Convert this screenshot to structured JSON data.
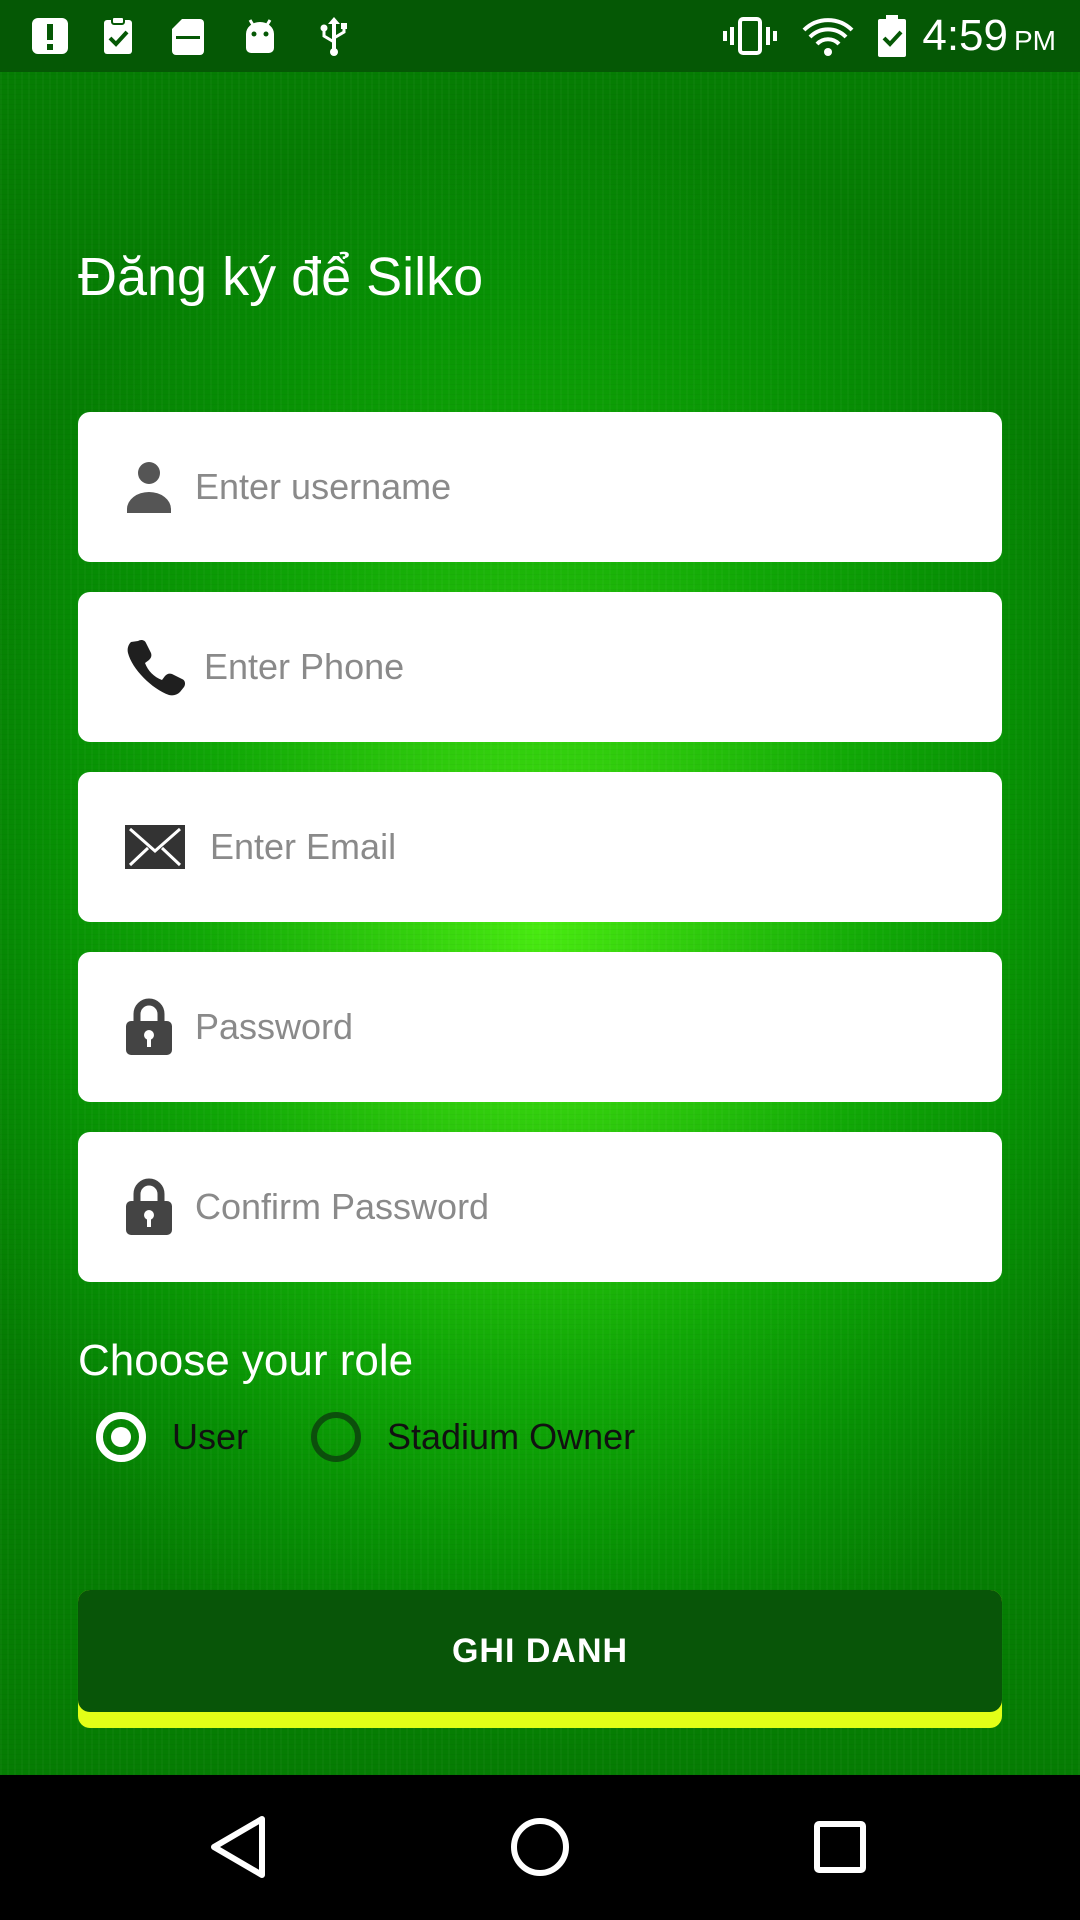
{
  "status_bar": {
    "time": "4:59",
    "ampm": "PM",
    "left_icons": [
      "alert-icon",
      "clipboard-check-icon",
      "sd-card-icon",
      "android-icon",
      "usb-icon"
    ],
    "right_icons": [
      "vibrate-icon",
      "wifi-icon",
      "battery-icon"
    ]
  },
  "title": "Đăng ký để Silko",
  "fields": {
    "username": {
      "placeholder": "Enter username",
      "icon": "person-icon"
    },
    "phone": {
      "placeholder": "Enter Phone",
      "icon": "phone-icon"
    },
    "email": {
      "placeholder": "Enter Email",
      "icon": "mail-icon"
    },
    "password": {
      "placeholder": "Password",
      "icon": "lock-icon"
    },
    "confirm_password": {
      "placeholder": "Confirm Password",
      "icon": "lock-icon"
    }
  },
  "role": {
    "title": "Choose your role",
    "options": [
      {
        "label": "User",
        "selected": true
      },
      {
        "label": "Stadium Owner",
        "selected": false
      }
    ]
  },
  "submit_label": "GHI DANH",
  "colors": {
    "status_bar": "#055805",
    "background_center": "#48ea10",
    "background_edge": "#057d03",
    "button": "#085508",
    "button_accent": "#e2ff17",
    "field_background": "#ffffff"
  },
  "nav_bar": {
    "buttons": [
      "back-icon",
      "home-icon",
      "recents-icon"
    ]
  }
}
